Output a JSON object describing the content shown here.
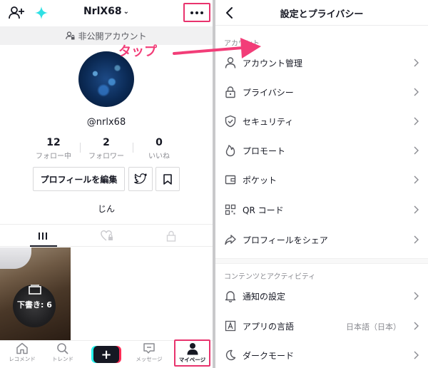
{
  "profile": {
    "username": "NrlX68",
    "private_notice": "非公開アカウント",
    "handle": "@nrlx68",
    "stats": [
      {
        "value": "12",
        "label": "フォロー中"
      },
      {
        "value": "2",
        "label": "フォロワー"
      },
      {
        "value": "0",
        "label": "いいね"
      }
    ],
    "edit_profile_label": "プロフィールを編集",
    "bio": "じん",
    "draft_label": "下書き: 6"
  },
  "annotation": {
    "tap_text": "タップ",
    "accent_color": "#e8336d"
  },
  "bottom_nav": {
    "home": "レコメンド",
    "discover": "トレンド",
    "inbox": "メッセージ",
    "me": "マイページ"
  },
  "settings": {
    "title": "設定とプライバシー",
    "sections": [
      {
        "label": "アカウント",
        "items": [
          {
            "label": "アカウント管理",
            "icon": "person-icon"
          },
          {
            "label": "プライバシー",
            "icon": "lock-icon"
          },
          {
            "label": "セキュリティ",
            "icon": "shield-icon"
          },
          {
            "label": "プロモート",
            "icon": "flame-icon"
          },
          {
            "label": "ポケット",
            "icon": "wallet-icon"
          },
          {
            "label": "QR コード",
            "icon": "qr-code-icon"
          },
          {
            "label": "プロフィールをシェア",
            "icon": "share-icon"
          }
        ]
      },
      {
        "label": "コンテンツとアクティビティ",
        "items": [
          {
            "label": "通知の設定",
            "icon": "bell-icon"
          },
          {
            "label": "アプリの言語",
            "icon": "language-icon",
            "value": "日本語（日本）"
          },
          {
            "label": "ダークモード",
            "icon": "moon-icon"
          }
        ]
      }
    ]
  }
}
